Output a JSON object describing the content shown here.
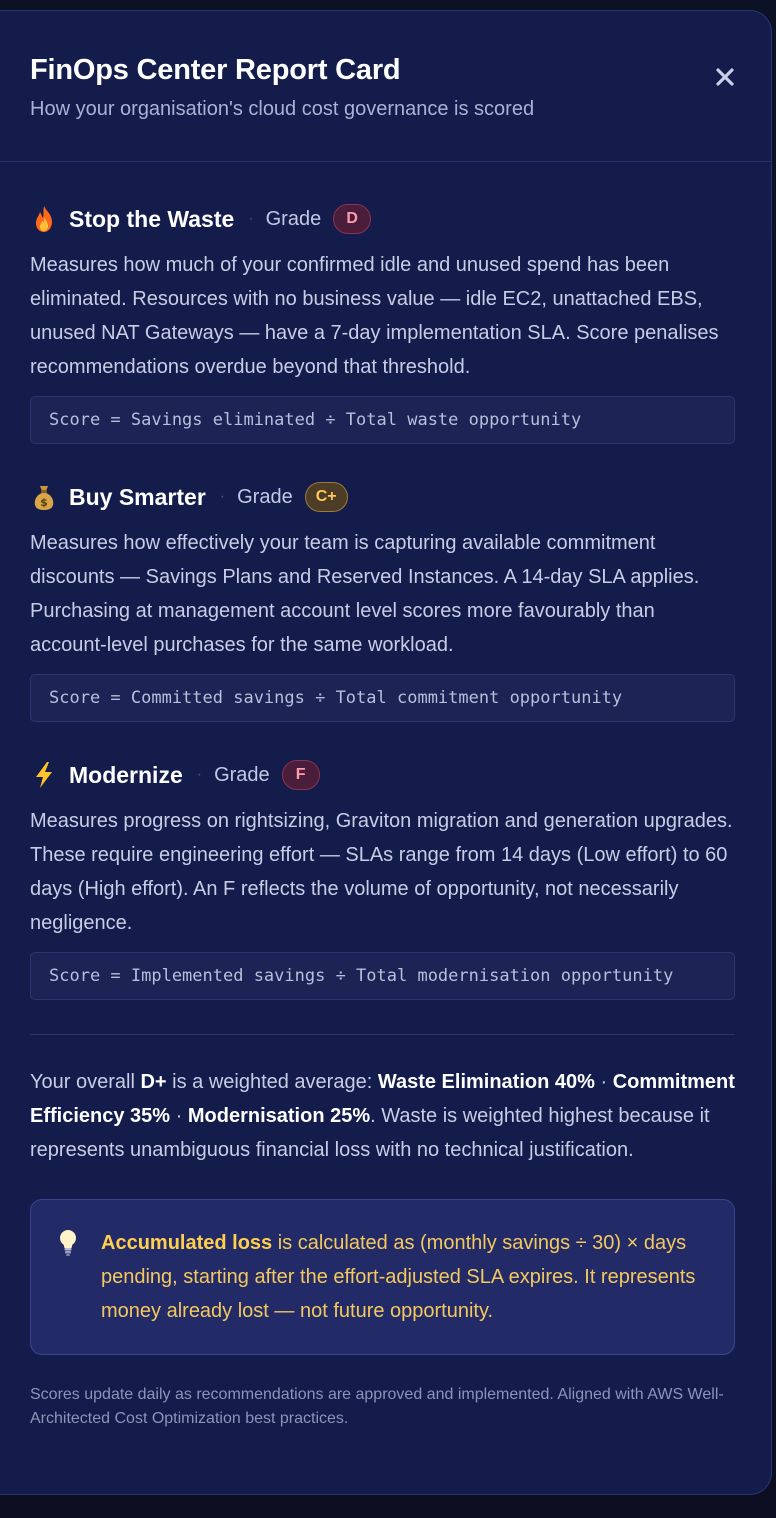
{
  "modal": {
    "title": "FinOps Center Report Card",
    "subtitle": "How your organisation's cloud cost governance is scored",
    "close_icon": "close-icon"
  },
  "grade_label": "Grade",
  "sections": [
    {
      "icon": "fire-icon",
      "title": "Stop the Waste",
      "grade": "D",
      "grade_color": "#ff9cb0",
      "description": "Measures how much of your confirmed idle and unused spend has been eliminated. Resources with no business value — idle EC2, unattached EBS, unused NAT Gateways — have a 7-day implementation SLA. Score penalises recommendations overdue beyond that threshold.",
      "formula": "Score = Savings eliminated ÷ Total waste opportunity"
    },
    {
      "icon": "money-bag-icon",
      "title": "Buy Smarter",
      "grade": "C+",
      "grade_color": "#ffc857",
      "description": "Measures how effectively your team is capturing available commitment discounts — Savings Plans and Reserved Instances. A 14-day SLA applies. Purchasing at management account level scores more favourably than account-level purchases for the same workload.",
      "formula": "Score = Committed savings ÷ Total commitment opportunity"
    },
    {
      "icon": "lightning-icon",
      "title": "Modernize",
      "grade": "F",
      "grade_color": "#ff9cb0",
      "description": "Measures progress on rightsizing, Graviton migration and generation upgrades. These require engineering effort — SLAs range from 14 days (Low effort) to 60 days (High effort). An F reflects the volume of opportunity, not necessarily negligence.",
      "formula": "Score = Implemented savings ÷ Total modernisation opportunity"
    }
  ],
  "summary": {
    "prefix": "Your overall ",
    "overall_grade": "D+",
    "middle": " is a weighted average: ",
    "weight_1": "Waste Elimination 40%",
    "sep_1": " · ",
    "weight_2": "Commitment Efficiency 35%",
    "sep_2": " · ",
    "weight_3": "Modernisation 25%",
    "suffix": ". Waste is weighted highest because it represents unambiguous financial loss with no technical justification."
  },
  "callout": {
    "icon": "lightbulb-icon",
    "bold": "Accumulated loss",
    "text": " is calculated as (monthly savings ÷ 30) × days pending, starting after the effort-adjusted SLA expires. It represents money already lost — not future opportunity."
  },
  "footer_note": "Scores update daily as recommendations are approved and implemented. Aligned with AWS Well-Architected Cost Optimization best practices.",
  "colors": {
    "modal_bg": "#131c4a",
    "accent_warning": "#f3c95e",
    "grade_red": "#ff9cb0",
    "grade_amber": "#ffc857"
  }
}
